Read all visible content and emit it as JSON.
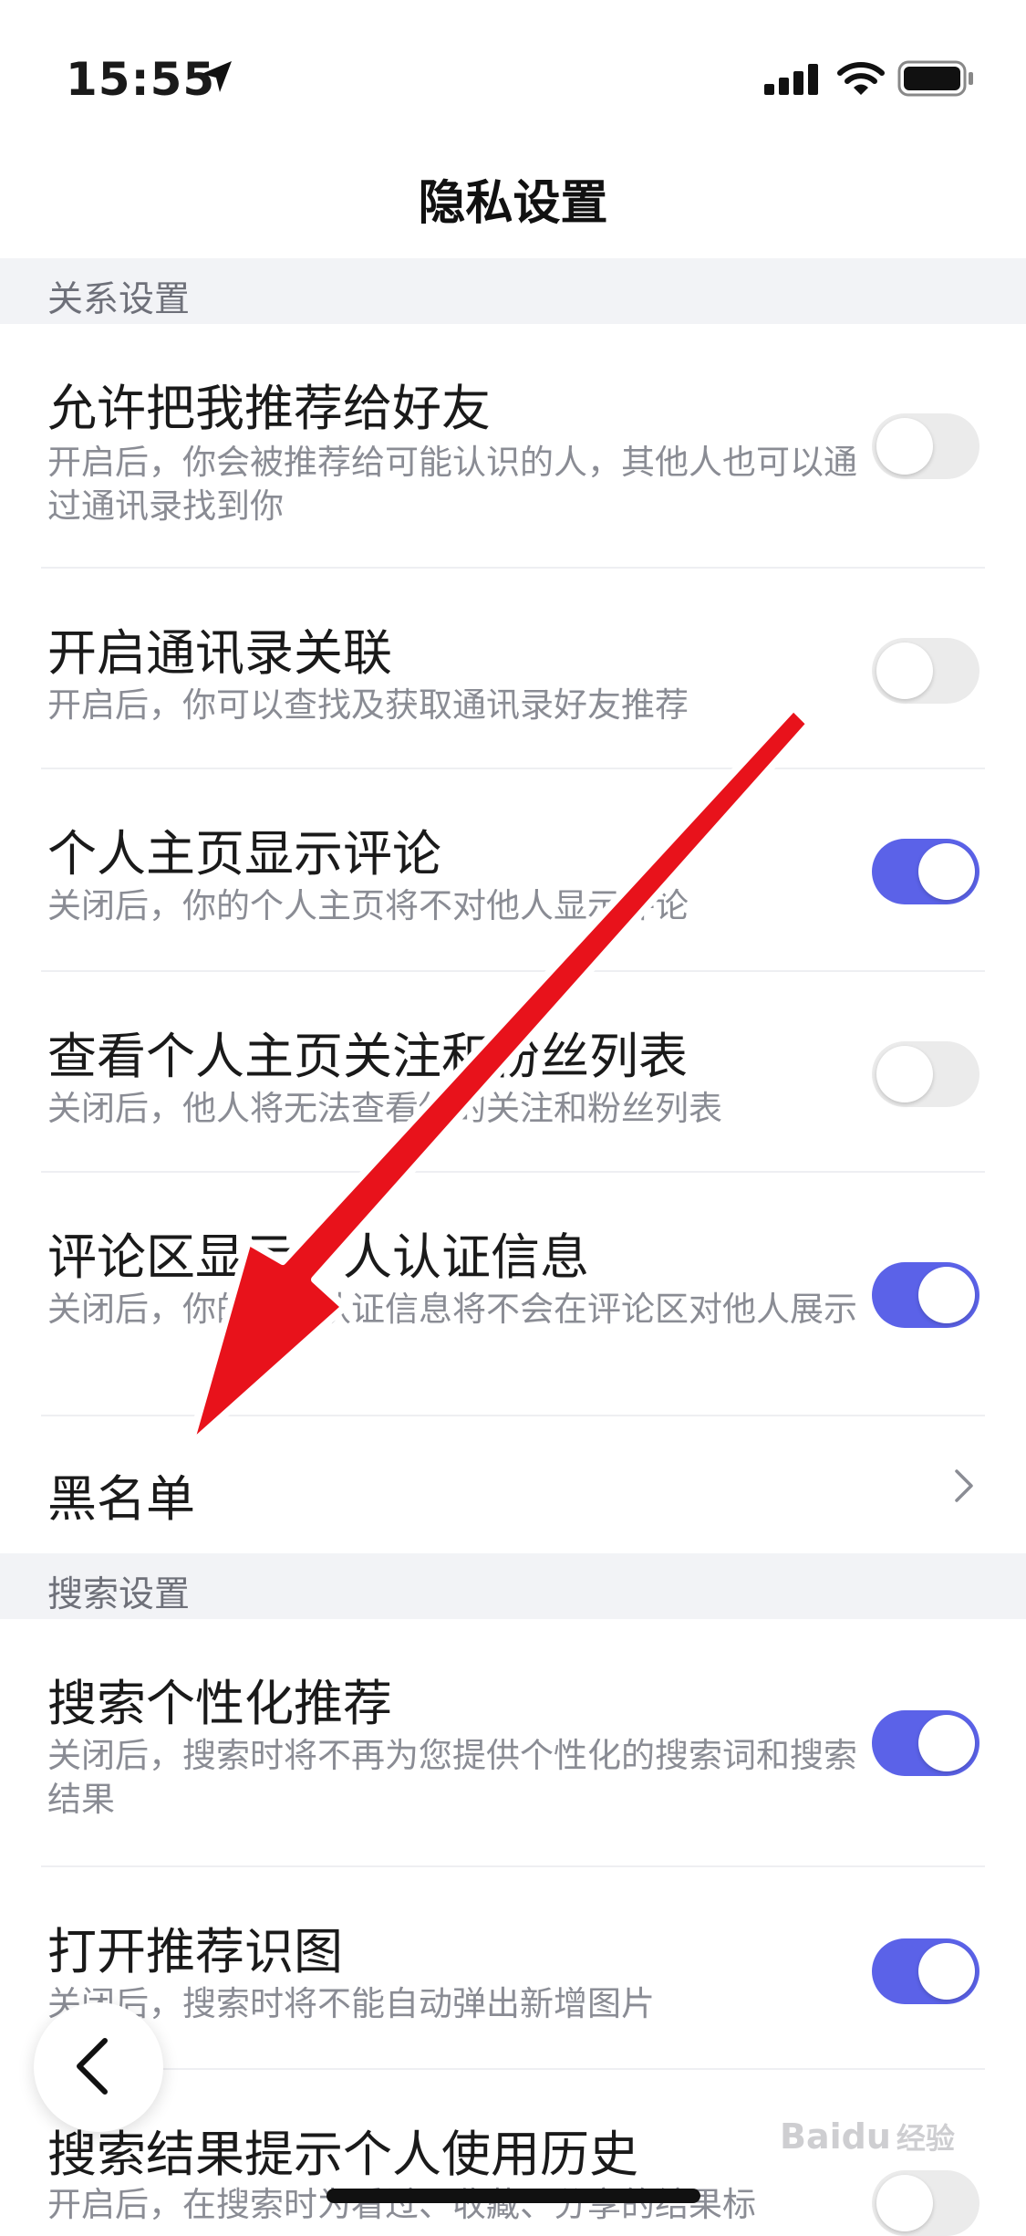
{
  "status_bar": {
    "time": "15:55",
    "icons": [
      "location-arrow-icon",
      "signal-icon",
      "wifi-icon",
      "battery-icon"
    ]
  },
  "nav": {
    "title": "隐私设置"
  },
  "sections": [
    {
      "header": "关系设置",
      "items": [
        {
          "title": "允许把我推荐给好友",
          "desc": "开启后，你会被推荐给可能认识的人，其他人也可以通过通讯录找到你",
          "toggle": false
        },
        {
          "title": "开启通讯录关联",
          "desc": "开启后，你可以查找及获取通讯录好友推荐",
          "toggle": false
        },
        {
          "title": "个人主页显示评论",
          "desc": "关闭后，你的个人主页将不对他人显示评论",
          "toggle": true
        },
        {
          "title": "查看个人主页关注和粉丝列表",
          "desc": "关闭后，他人将无法查看你的关注和粉丝列表",
          "toggle": false
        },
        {
          "title": "评论区显示个人认证信息",
          "desc": "关闭后，你的个人认证信息将不会在评论区对他人展示",
          "toggle": true
        },
        {
          "title": "黑名单",
          "type": "link",
          "icon": "chevron-right-icon"
        }
      ]
    },
    {
      "header": "搜索设置",
      "items": [
        {
          "title": "搜索个性化推荐",
          "desc": "关闭后，搜索时将不再为您提供个性化的搜索词和搜索结果",
          "toggle": true
        },
        {
          "title": "打开推荐识图",
          "desc": "关闭后，搜索时将不能自动弹出新增图片",
          "toggle": true
        },
        {
          "title": "搜索结果提示个人使用历史",
          "desc": "开启后，在搜索时为看过、收藏、分享的结果标",
          "toggle": false
        }
      ]
    }
  ],
  "floating": {
    "back_icon": "chevron-left-icon"
  },
  "annotation": {
    "icon": "red-arrow-annotation",
    "color": "#e8121b"
  },
  "watermark": {
    "brand": "Baidu",
    "suffix": "经验"
  },
  "colors": {
    "toggle_on": "#5b62e8",
    "toggle_off": "#ebebeb",
    "section_bg": "#f2f3f6"
  }
}
